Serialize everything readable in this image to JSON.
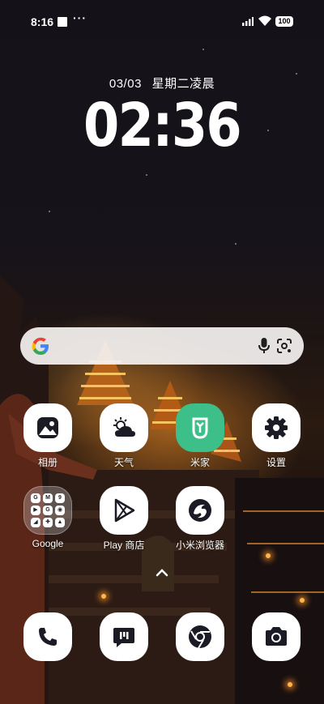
{
  "status_bar": {
    "time": "8:16",
    "extra": "···",
    "battery": "100"
  },
  "lockclock": {
    "date": "03/03",
    "weekday": "星期二凌晨",
    "time": "02:36"
  },
  "search": {
    "engine": "Google"
  },
  "apps": [
    {
      "label": "相册"
    },
    {
      "label": "天气"
    },
    {
      "label": "米家"
    },
    {
      "label": "设置"
    },
    {
      "label": "Google"
    },
    {
      "label": "Play 商店"
    },
    {
      "label": "小米浏览器"
    }
  ],
  "folder_icons": [
    "G",
    "M",
    "9",
    "▶",
    "G",
    "◉",
    "◢",
    "✚",
    "▲"
  ],
  "dock": [
    "phone",
    "messages",
    "chrome",
    "camera"
  ],
  "colors": {
    "mijia_green": "#3dbf8a",
    "icon_dark": "#1b1b26",
    "search_bg": "#f4f1f0"
  }
}
